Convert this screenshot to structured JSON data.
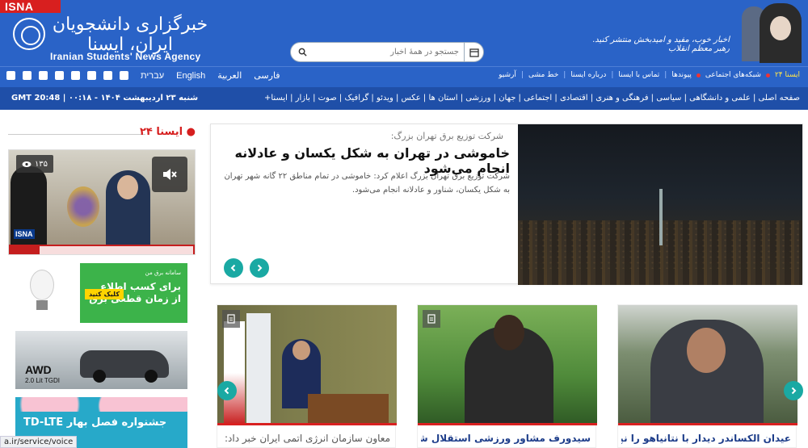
{
  "header": {
    "brand_tag": "ISNA",
    "logo_fa": "خبرگزاری دانشجویان ایران، ایسنا",
    "logo_en": "Iranian Students' News Agency",
    "slogan": "اخبار خوب، مفید و امیدبخش منتشر کنید. رهبر معظم انقلاب",
    "search_placeholder": "جستجو در همهٔ اخبار"
  },
  "nav_top": {
    "languages": [
      "فارسی",
      "العربية",
      "English",
      "עברית"
    ],
    "links": [
      "آرشیو",
      "خط مشی",
      "درباره ایسنا",
      "تماس با ایسنا",
      "پیوندها",
      "شبکه‌های اجتماعی",
      "ایسنا ۲۴"
    ]
  },
  "nav_main": {
    "date": "GMT 20:48   |   شنبه ۲۳ اردیبهشت ۱۴۰۴ - ۰۰:۱۸",
    "categories": "صفحه اصلی | علمی و دانشگاهی | سیاسی | فرهنگی و هنری | اقتصادی | اجتماعی | جهان | ورزشی | استان ها | عکس | ویدئو | گرافیک | صوت | بازار | ایسنا+"
  },
  "sidebar": {
    "title": "ایسنا ۲۴",
    "video_views": "۱۳۵",
    "video_brand": "ISNA",
    "ads": {
      "power_small": "سامانه برق من",
      "power_text": "برای کسب اطلاع از زمان قطعی برق",
      "power_button": "کلیک کنید",
      "car_model": "AWD",
      "car_engine": "2.0 Lit TGDI",
      "tdlte": "جشنواره فصل بهار TD-LTE"
    },
    "status_url": "a.ir/service/voice"
  },
  "lead": {
    "kicker": "شرکت توزیع برق تهران بزرگ:",
    "headline": "خاموشی در تهران به شکل یکسان و عادلانه انجام می‌شود",
    "summary": "شرکت توزیع برق تهران بزرگ اعلام کرد: خاموشی در تمام مناطق ۲۲ گانه شهر تهران به شکل یکسان، شناور و عادلانه انجام می‌شود."
  },
  "cards": [
    {
      "text": "معاون سازمان انرژی اتمی ایران خبر داد:"
    },
    {
      "text": "سیدورف مشاور ورزشی استقلال شد"
    },
    {
      "text": "عیدان الکساندر دیدار با نتانیاهو را نپذیرفت"
    }
  ]
}
